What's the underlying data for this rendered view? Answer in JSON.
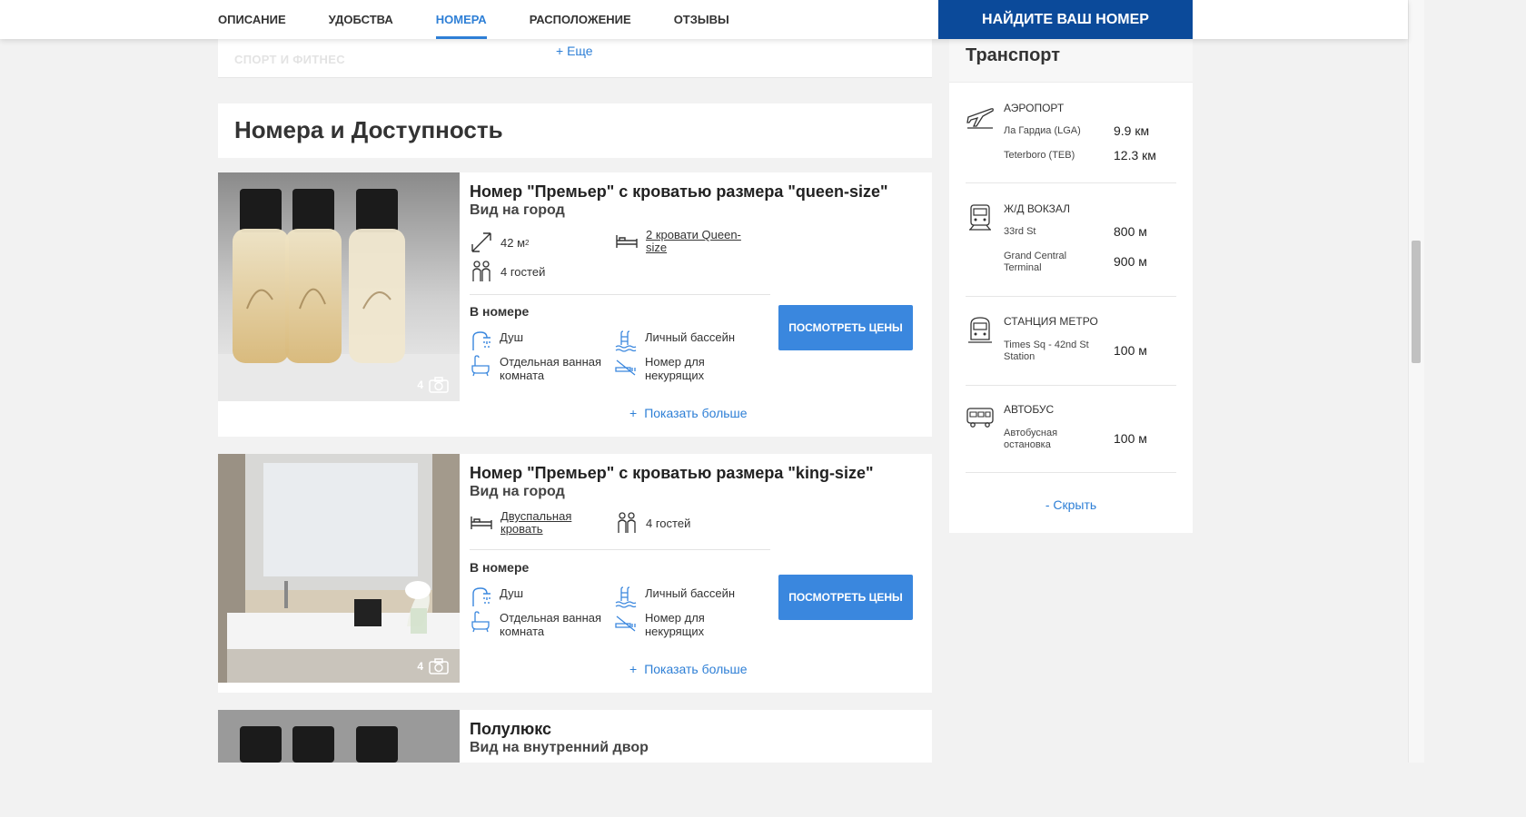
{
  "nav": {
    "tabs": [
      {
        "label": "ОПИСАНИЕ"
      },
      {
        "label": "УДОБСТВА"
      },
      {
        "label": "НОМЕРА",
        "active": true
      },
      {
        "label": "РАСПОЛОЖЕНИЕ"
      },
      {
        "label": "ОТЗЫВЫ"
      }
    ],
    "find_button": "НАЙДИТЕ ВАШ НОМЕР"
  },
  "amenities_tail": {
    "ghost_label": "СПОРТ И ФИТНЕС",
    "more_link": "+ Еще"
  },
  "rooms_section": {
    "title": "Номера и Доступность"
  },
  "rooms": [
    {
      "title": "Номер \"Премьер\" с кроватью размера \"queen-size\"",
      "subtitle": "Вид на город",
      "photo_count": "4",
      "size": "42 м",
      "size_sup": "2",
      "guests": "4 гостей",
      "beds": "2 кровати Queen-size",
      "inroom_label": "В номере",
      "amenities": [
        "Душ",
        "Личный бассейн",
        "Отдельная ванная комната",
        "Номер для некурящих"
      ],
      "price_button": "ПОСМОТРЕТЬ ЦЕНЫ",
      "show_more": "Показать больше"
    },
    {
      "title": "Номер \"Премьер\" с кроватью размера \"king-size\"",
      "subtitle": "Вид на город",
      "photo_count": "4",
      "beds": "Двуспальная кровать",
      "guests": "4 гостей",
      "inroom_label": "В номере",
      "amenities": [
        "Душ",
        "Личный бассейн",
        "Отдельная ванная комната",
        "Номер для некурящих"
      ],
      "price_button": "ПОСМОТРЕТЬ ЦЕНЫ",
      "show_more": "Показать больше"
    },
    {
      "title": "Полулюкс",
      "subtitle": "Вид на внутренний двор"
    }
  ],
  "transport": {
    "title": "Транспорт",
    "groups": [
      {
        "name": "АЭРОПОРТ",
        "icon": "airplane-icon",
        "items": [
          {
            "place": "Ла Гардиа (LGA)",
            "distance": "9.9 км"
          },
          {
            "place": "Teterboro (TEB)",
            "distance": "12.3 км"
          }
        ]
      },
      {
        "name": "Ж/Д ВОКЗАЛ",
        "icon": "train-icon",
        "items": [
          {
            "place": "33rd St",
            "distance": "800 м"
          },
          {
            "place": "Grand Central Terminal",
            "distance": "900 м"
          }
        ]
      },
      {
        "name": "СТАНЦИЯ МЕТРО",
        "icon": "subway-icon",
        "items": [
          {
            "place": "Times Sq - 42nd St Station",
            "distance": "100 м"
          }
        ]
      },
      {
        "name": "АВТОБУС",
        "icon": "bus-icon",
        "items": [
          {
            "place": "Автобусная остановка",
            "distance": "100 м"
          }
        ]
      }
    ],
    "hide_link": "- Скрыть"
  },
  "colors": {
    "accent": "#2e7fd6",
    "brand_button": "#0b4a9a",
    "price_button": "#3a87de",
    "background": "#f2f2f2"
  }
}
